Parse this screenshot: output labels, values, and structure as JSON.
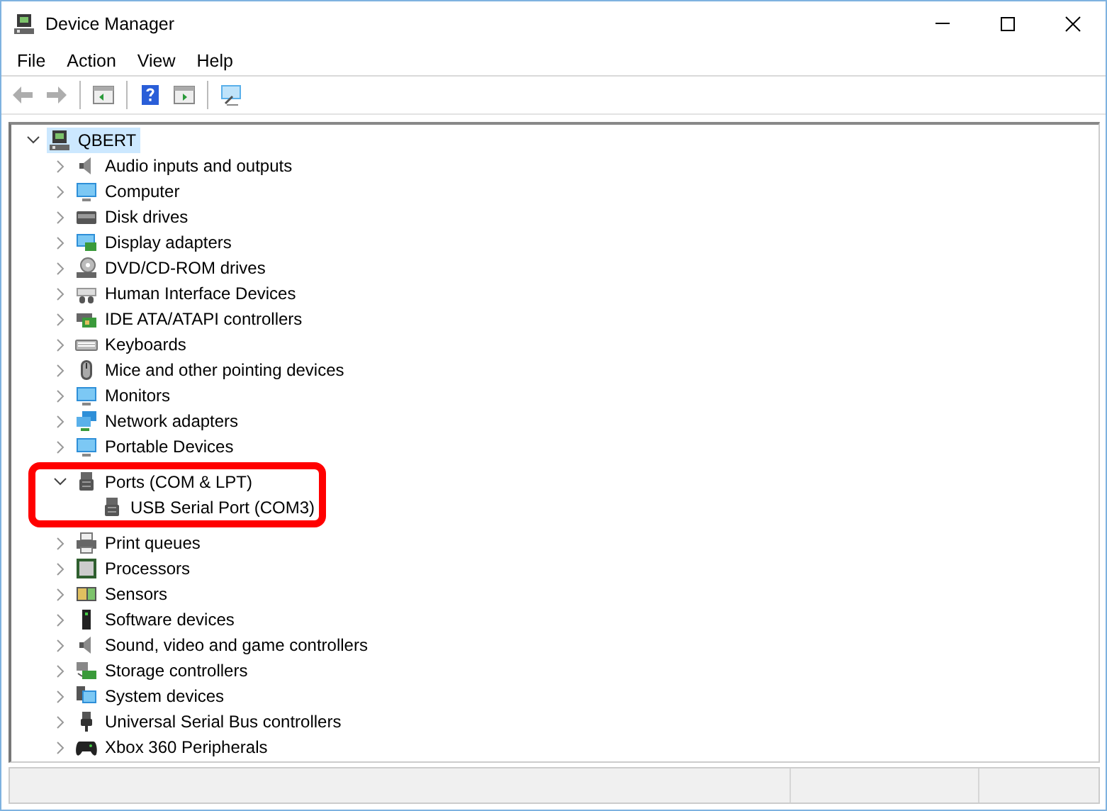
{
  "window": {
    "title": "Device Manager"
  },
  "menu": [
    {
      "label": "File"
    },
    {
      "label": "Action"
    },
    {
      "label": "View"
    },
    {
      "label": "Help"
    }
  ],
  "toolbar": [
    {
      "kind": "back",
      "disabled": true
    },
    {
      "kind": "forward",
      "disabled": true
    },
    {
      "kind": "separator"
    },
    {
      "kind": "console",
      "disabled": false
    },
    {
      "kind": "separator"
    },
    {
      "kind": "help",
      "disabled": false
    },
    {
      "kind": "properties",
      "disabled": false
    },
    {
      "kind": "separator"
    },
    {
      "kind": "scan",
      "disabled": false
    }
  ],
  "tree": {
    "label": "QBERT",
    "expanded": true,
    "selected": true,
    "children": [
      {
        "label": "Audio inputs and outputs",
        "expanded": false,
        "selected": false
      },
      {
        "label": "Computer",
        "expanded": false,
        "selected": false
      },
      {
        "label": "Disk drives",
        "expanded": false,
        "selected": false
      },
      {
        "label": "Display adapters",
        "expanded": false,
        "selected": false
      },
      {
        "label": "DVD/CD-ROM drives",
        "expanded": false,
        "selected": false
      },
      {
        "label": "Human Interface Devices",
        "expanded": false,
        "selected": false
      },
      {
        "label": "IDE ATA/ATAPI controllers",
        "expanded": false,
        "selected": false
      },
      {
        "label": "Keyboards",
        "expanded": false,
        "selected": false
      },
      {
        "label": "Mice and other pointing devices",
        "expanded": false,
        "selected": false
      },
      {
        "label": "Monitors",
        "expanded": false,
        "selected": false
      },
      {
        "label": "Network adapters",
        "expanded": false,
        "selected": false
      },
      {
        "label": "Portable Devices",
        "expanded": false,
        "selected": false
      },
      {
        "label": "Ports (COM & LPT)",
        "expanded": true,
        "selected": false,
        "children": [
          {
            "label": "USB Serial Port (COM3)",
            "selected": false
          }
        ]
      },
      {
        "label": "Print queues",
        "expanded": false,
        "selected": false
      },
      {
        "label": "Processors",
        "expanded": false,
        "selected": false
      },
      {
        "label": "Sensors",
        "expanded": false,
        "selected": false
      },
      {
        "label": "Software devices",
        "expanded": false,
        "selected": false
      },
      {
        "label": "Sound, video and game controllers",
        "expanded": false,
        "selected": false
      },
      {
        "label": "Storage controllers",
        "expanded": false,
        "selected": false
      },
      {
        "label": "System devices",
        "expanded": false,
        "selected": false
      },
      {
        "label": "Universal Serial Bus controllers",
        "expanded": false,
        "selected": false
      },
      {
        "label": "Xbox 360 Peripherals",
        "expanded": false,
        "selected": false
      }
    ]
  },
  "highlight": {
    "visible": true
  }
}
